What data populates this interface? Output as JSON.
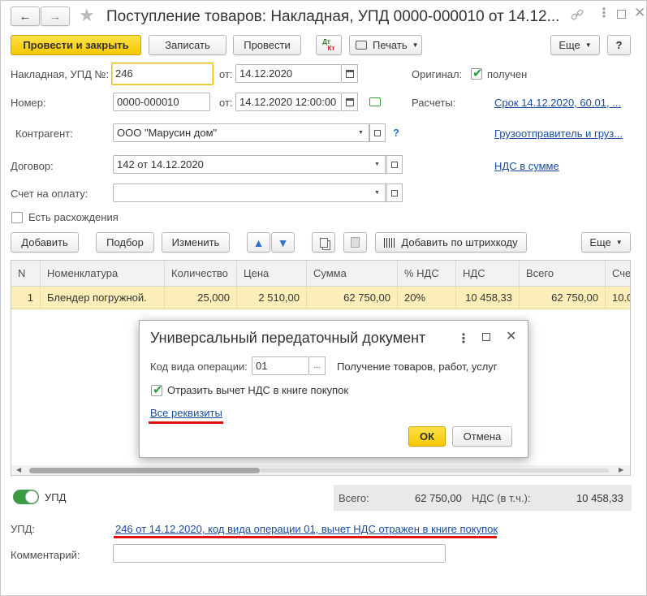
{
  "window": {
    "title": "Поступление товаров: Накладная, УПД 0000-000010 от 14.12..."
  },
  "toolbar": {
    "post_close": "Провести и закрыть",
    "save": "Записать",
    "post": "Провести",
    "dtkt_top": "Дт",
    "dtkt_bottom": "Кт",
    "print": "Печать",
    "more": "Еще",
    "help": "?"
  },
  "form": {
    "invoice_label": "Накладная, УПД №:",
    "invoice_number": "246",
    "from_label": "от:",
    "invoice_date": "14.12.2020",
    "original_label": "Оригинал:",
    "original_value": "получен",
    "number_label": "Номер:",
    "number_value": "0000-000010",
    "from_label2": "от:",
    "number_datetime": "14.12.2020 12:00:00",
    "settlements_label": "Расчеты:",
    "settlements_link": "Срок 14.12.2020, 60.01, ...",
    "counterparty_label": "Контрагент:",
    "counterparty_value": "ООО \"Марусин дом\"",
    "help_q": "?",
    "shipper_link": "Грузоотправитель и груз...",
    "contract_label": "Договор:",
    "contract_value": "142 от 14.12.2020",
    "vat_link": "НДС в сумме",
    "payment_label": "Счет на оплату:",
    "payment_value": "",
    "discrepancy_label": "Есть расхождения"
  },
  "table_toolbar": {
    "add": "Добавить",
    "select": "Подбор",
    "edit": "Изменить",
    "barcode": "Добавить по штрихкоду",
    "more": "Еще"
  },
  "table": {
    "columns": [
      "N",
      "Номенклатура",
      "Количество",
      "Цена",
      "Сумма",
      "% НДС",
      "НДС",
      "Всего",
      "Сче"
    ],
    "rows": [
      [
        "1",
        "Блендер погружной.",
        "25,000",
        "2 510,00",
        "62 750,00",
        "20%",
        "10 458,33",
        "62 750,00",
        "10.0"
      ]
    ]
  },
  "dialog": {
    "title": "Универсальный передаточный документ",
    "op_label": "Код вида операции:",
    "op_code": "01",
    "op_desc": "Получение товаров, работ, услуг",
    "vat_checkbox": "Отразить вычет НДС в книге покупок",
    "all_details": "Все реквизиты",
    "ok": "ОК",
    "cancel": "Отмена",
    "ellipsis": "..."
  },
  "footer": {
    "upd_toggle_label": "УПД",
    "total_label": "Всего:",
    "total_value": "62 750,00",
    "vat_label": "НДС (в т.ч.):",
    "vat_value": "10 458,33",
    "upd_label": "УПД:",
    "upd_link": "246 от 14.12.2020, код вида операции 01, вычет НДС отражен в книге покупок",
    "comment_label": "Комментарий:",
    "comment_value": ""
  },
  "colors": {
    "accent_yellow": "#f5c800",
    "link_blue": "#1b4c9c",
    "highlight_red": "#e01010",
    "row_selected": "#fbeeb8",
    "check_green": "#27a040"
  }
}
